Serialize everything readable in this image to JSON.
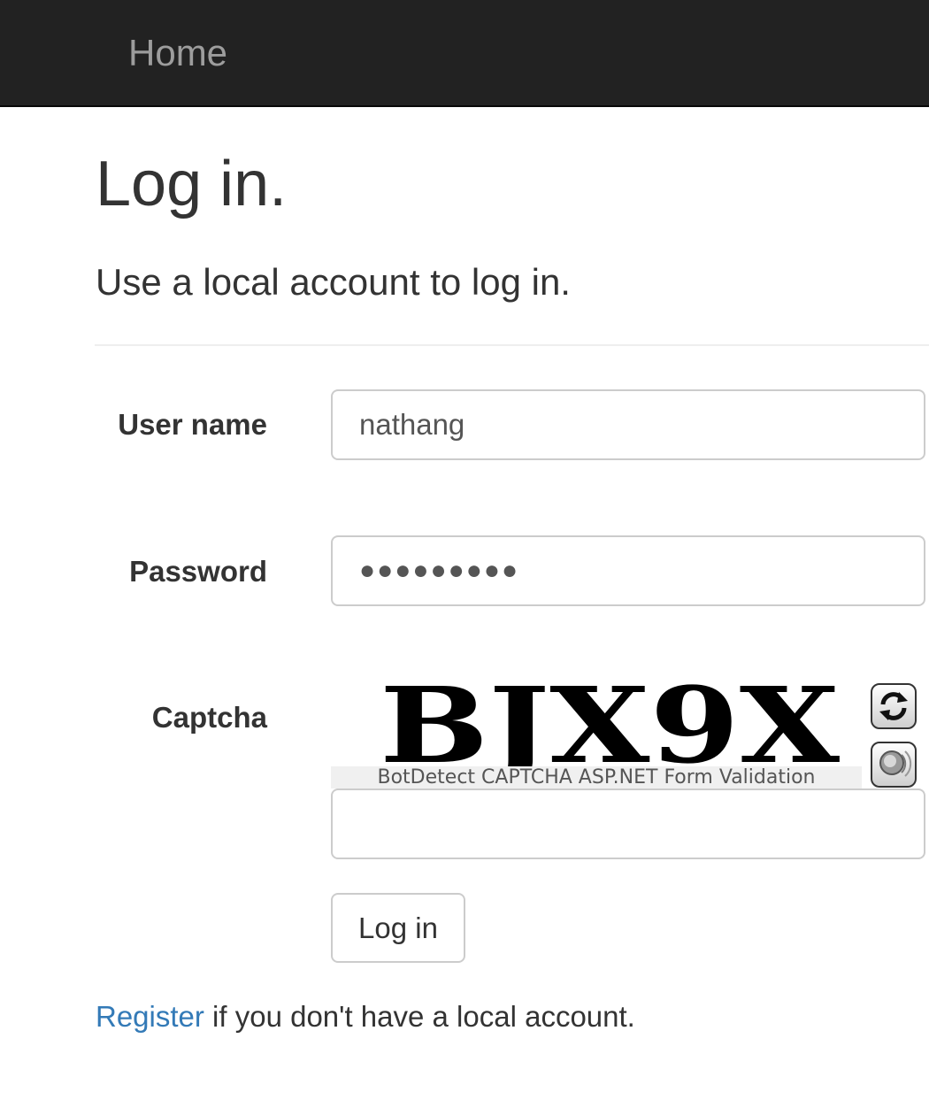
{
  "nav": {
    "home_label": "Home"
  },
  "page": {
    "title": "Log in.",
    "subtitle": "Use a local account to log in."
  },
  "form": {
    "username_label": "User name",
    "username_value": "nathang",
    "password_label": "Password",
    "password_masked": "●●●●●●●●●",
    "captcha_label": "Captcha",
    "captcha_code": "BJX9X",
    "captcha_caption": "BotDetect CAPTCHA ASP.NET Form Validation",
    "captcha_input_value": "",
    "submit_label": "Log in"
  },
  "footer": {
    "register_link": "Register",
    "register_text": " if you don't have a local account."
  },
  "icons": {
    "reload": "reload-icon",
    "sound": "sound-icon"
  },
  "colors": {
    "navbar_bg": "#222222",
    "nav_link": "#9d9d9d",
    "link": "#337ab7",
    "text": "#333333",
    "input_border": "#cccccc"
  }
}
